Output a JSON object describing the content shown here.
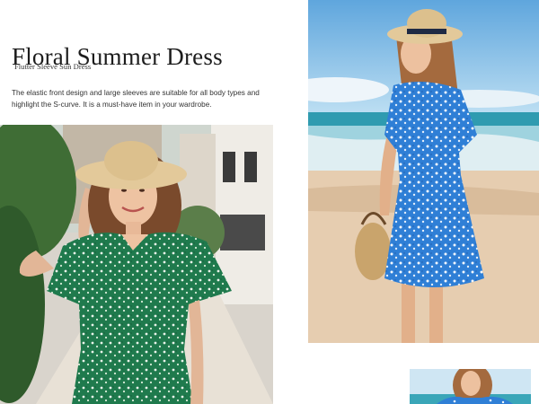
{
  "product": {
    "title": "Floral Summer Dress",
    "subtitle": "Flutter Sleeve Sun Dress",
    "description": "The elastic front design and large sleeves are suitable for all body types and highlight the S-curve. It is a must-have item in your wardrobe."
  },
  "colors": {
    "green_print": "#1f7a4d",
    "blue_print": "#2f7fd6",
    "sea": "#3aa6b8",
    "sky": "#8cc3ea",
    "sand": "#e6cdb0",
    "hat": "#e3c99a"
  },
  "images": [
    {
      "name": "model-green-dress",
      "icon": "photo-icon"
    },
    {
      "name": "model-blue-dress-beach",
      "icon": "photo-icon"
    },
    {
      "name": "model-blue-dress-thumbnail",
      "icon": "photo-icon"
    }
  ]
}
